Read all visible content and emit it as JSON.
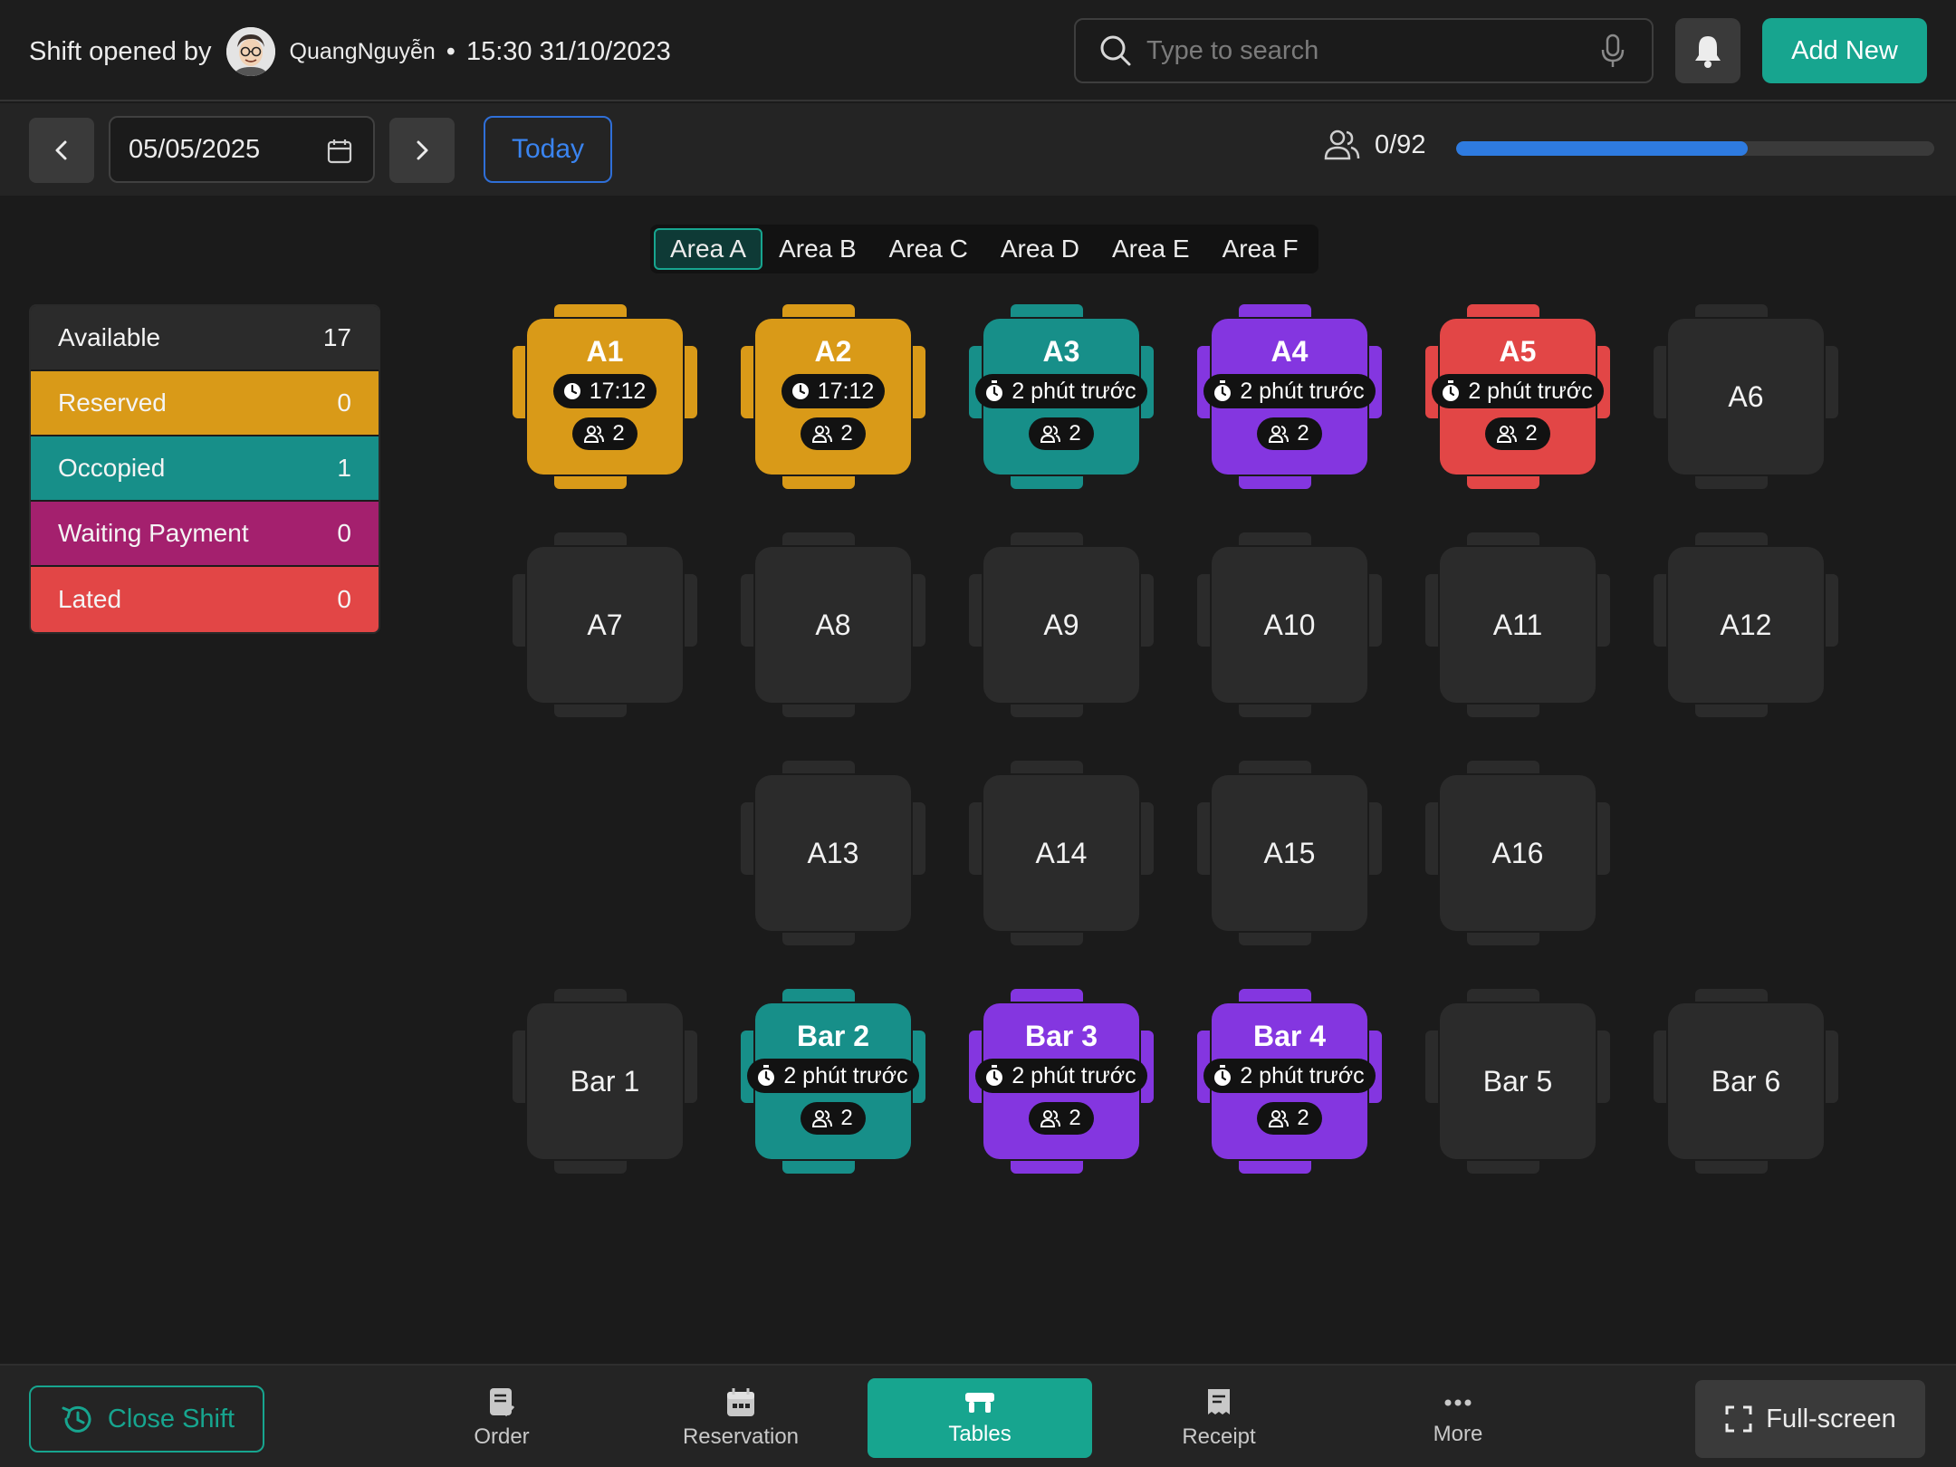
{
  "header": {
    "shift_label": "Shift opened by",
    "user_name": "QuangNguyễn",
    "separator": "•",
    "shift_time": "15:30 31/10/2023",
    "search_placeholder": "Type to search",
    "add_new_label": "Add New"
  },
  "datebar": {
    "date": "05/05/2025",
    "today_label": "Today",
    "guest_count": "0/92",
    "capacity_fill": 0.61
  },
  "area_tabs": [
    "Area A",
    "Area B",
    "Area C",
    "Area D",
    "Area E",
    "Area F"
  ],
  "active_area": "Area A",
  "legend": [
    {
      "label": "Available",
      "count": "17",
      "color": "#2b2b2b"
    },
    {
      "label": "Reserved",
      "count": "0",
      "color": "#d99a18"
    },
    {
      "label": "Occopied",
      "count": "1",
      "color": "#178f89"
    },
    {
      "label": "Waiting Payment",
      "count": "0",
      "color": "#a4206e"
    },
    {
      "label": "Lated",
      "count": "0",
      "color": "#e24646"
    }
  ],
  "tables": [
    {
      "name": "A1",
      "status": "reserved",
      "time": "17:12",
      "guests": "2",
      "icon": "clock-icon"
    },
    {
      "name": "A2",
      "status": "reserved",
      "time": "17:12",
      "guests": "2",
      "icon": "clock-icon"
    },
    {
      "name": "A3",
      "status": "occupied",
      "time": "2 phút trước",
      "guests": "2",
      "icon": "stopwatch-icon"
    },
    {
      "name": "A4",
      "status": "waiting",
      "time": "2 phút trước",
      "guests": "2",
      "icon": "stopwatch-icon"
    },
    {
      "name": "A5",
      "status": "lated",
      "time": "2 phút trước",
      "guests": "2",
      "icon": "stopwatch-icon"
    },
    {
      "name": "A6",
      "status": "available"
    },
    {
      "name": "A7",
      "status": "available"
    },
    {
      "name": "A8",
      "status": "available"
    },
    {
      "name": "A9",
      "status": "available"
    },
    {
      "name": "A10",
      "status": "available"
    },
    {
      "name": "A11",
      "status": "available"
    },
    {
      "name": "A12",
      "status": "available"
    },
    {
      "name": "A13",
      "status": "available"
    },
    {
      "name": "A14",
      "status": "available"
    },
    {
      "name": "A15",
      "status": "available"
    },
    {
      "name": "A16",
      "status": "available"
    },
    {
      "name": "Bar 1",
      "status": "available"
    },
    {
      "name": "Bar 2",
      "status": "occupied",
      "time": "2 phút trước",
      "guests": "2",
      "icon": "stopwatch-icon"
    },
    {
      "name": "Bar 3",
      "status": "waiting",
      "time": "2 phút trước",
      "guests": "2",
      "icon": "stopwatch-icon"
    },
    {
      "name": "Bar 4",
      "status": "waiting",
      "time": "2 phút trước",
      "guests": "2",
      "icon": "stopwatch-icon"
    },
    {
      "name": "Bar 5",
      "status": "available"
    },
    {
      "name": "Bar 6",
      "status": "available"
    }
  ],
  "bottom": {
    "close_shift_label": "Close Shift",
    "nav": [
      {
        "label": "Order",
        "icon": "order-icon"
      },
      {
        "label": "Reservation",
        "icon": "calendar-icon"
      },
      {
        "label": "Tables",
        "icon": "table-icon",
        "active": true
      },
      {
        "label": "Receipt",
        "icon": "receipt-icon"
      },
      {
        "label": "More",
        "icon": "more-icon"
      }
    ],
    "fullscreen_label": "Full-screen"
  },
  "colors": {
    "accent": "#17a58f",
    "reserved": "#d99a18",
    "occupied": "#178f89",
    "waiting": "#8436e0",
    "lated": "#e24646",
    "progress": "#2e7be0"
  }
}
